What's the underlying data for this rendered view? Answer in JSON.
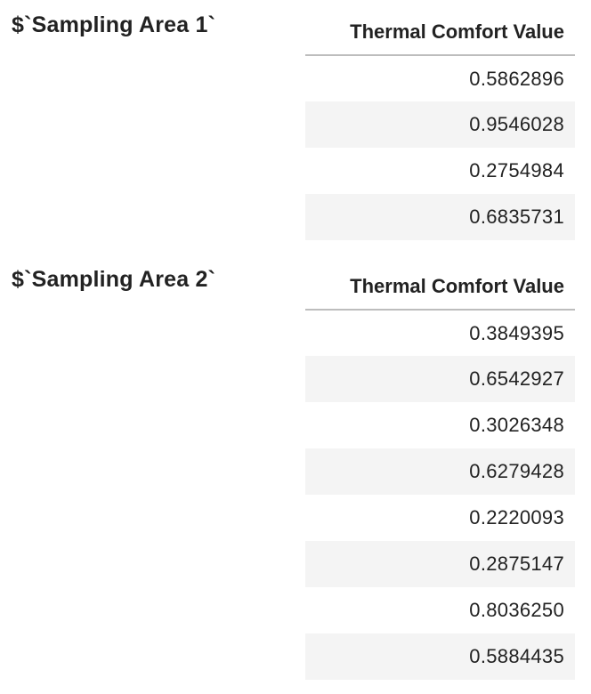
{
  "sections": [
    {
      "title": "$`Sampling Area 1`",
      "table": {
        "columns": [
          "Thermal Comfort Value"
        ],
        "rows": [
          "0.5862896",
          "0.9546028",
          "0.2754984",
          "0.6835731"
        ]
      }
    },
    {
      "title": "$`Sampling Area 2`",
      "table": {
        "columns": [
          "Thermal Comfort Value"
        ],
        "rows": [
          "0.3849395",
          "0.6542927",
          "0.3026348",
          "0.6279428",
          "0.2220093",
          "0.2875147",
          "0.8036250",
          "0.5884435"
        ]
      }
    }
  ],
  "colors": {
    "text": "#222222",
    "stripe": "#f4f4f4",
    "header_rule": "#bdbdbd",
    "background": "#ffffff"
  }
}
